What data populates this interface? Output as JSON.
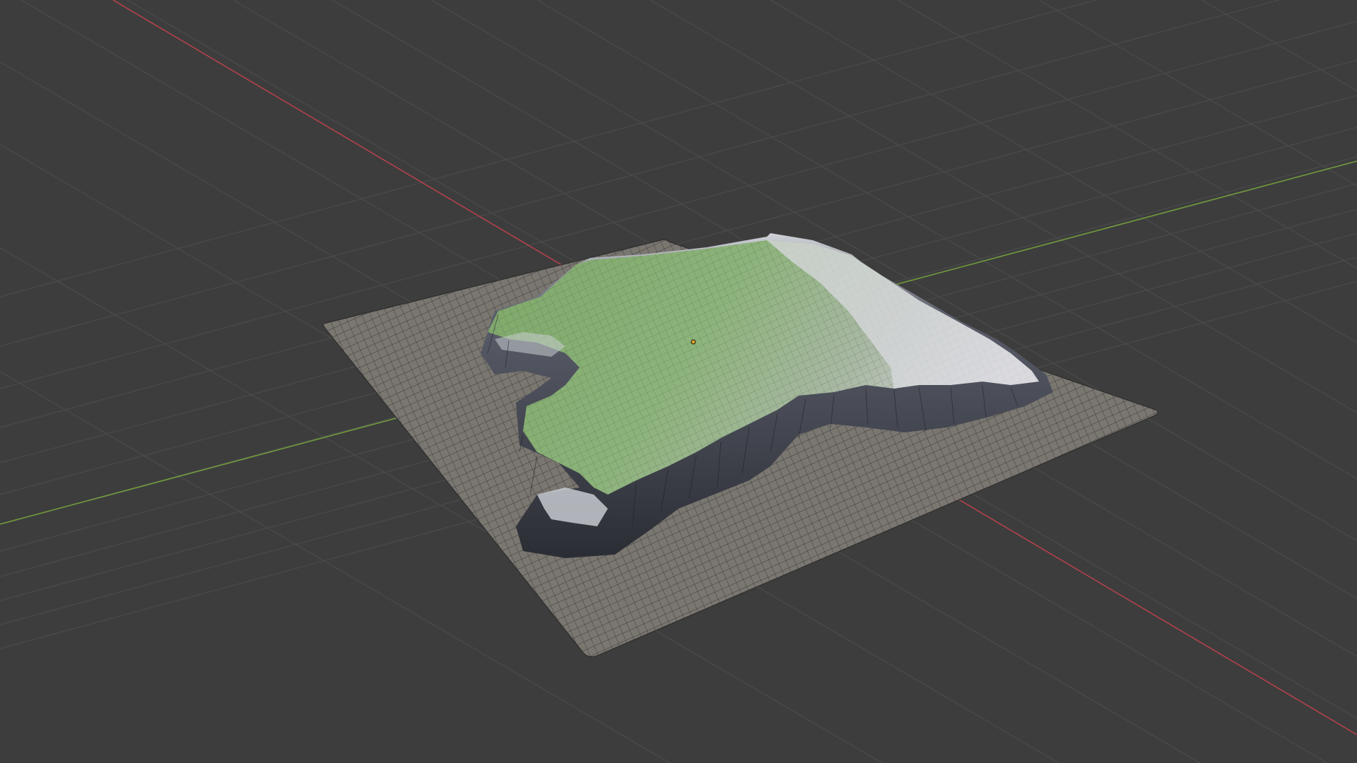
{
  "viewport": {
    "mode": "3d-view",
    "background_color": "#3d3d3d",
    "grid_color": "#4a4a4a",
    "axis_x_color": "#c8424e",
    "axis_y_color": "#7aa83c",
    "origin_marker_color": "#e0a020"
  },
  "scene": {
    "objects": [
      {
        "name": "ground-plane",
        "kind": "subdivided-mesh-plane",
        "color": "#7a7670",
        "wire_color": "#2a2a2a"
      },
      {
        "name": "terrain",
        "kind": "displaced-terrain-mesh",
        "top_color": "#8fae7a",
        "snow_color": "#d8d8dc",
        "cliff_color": "#3c3f48"
      }
    ]
  }
}
